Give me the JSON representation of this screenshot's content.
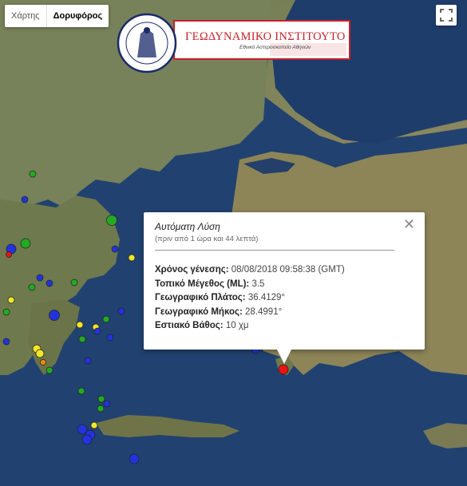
{
  "map_type_control": {
    "map_label": "Χάρτης",
    "satellite_label": "Δορυφόρος",
    "active": "satellite"
  },
  "logo": {
    "title": "ΓΕΩΔΥΝΑΜΙΚΟ ΙΝΣΤΙΤΟΥΤΟ",
    "subtitle": "Εθνικό Αστεροσκοπείο Αθηνών",
    "seal_text": "ΕΘΝΙΚΟΝ ΑΣΤΕΡΟΣΚΟΠΕΙΟΝ ΑΘΗΝΩΝ · NATIONAL OBSERVATORY OF ATHENS"
  },
  "popup": {
    "title": "Αυτόματη Λύση",
    "time_ago": "(πριν από 1 ώρα και 44 λεπτά)",
    "rows": [
      {
        "label": "Χρόνος γένεσης:",
        "value": "08/08/2018  09:58:38 (GMT)"
      },
      {
        "label": "Τοπικό Μέγεθος (ML):",
        "value": "3.5"
      },
      {
        "label": "Γεωγραφικό Πλάτος:",
        "value": "36.4129°"
      },
      {
        "label": "Γεωγραφικό Μήκος:",
        "value": "28.4991°"
      },
      {
        "label": "Εστιακό Βάθος:",
        "value": "10 χμ"
      }
    ]
  },
  "colors": {
    "sea": "#1f3f66",
    "land": "#6f7d52",
    "marker_blue": "#2233dd",
    "marker_green": "#22aa22",
    "marker_yellow": "#f2e62a",
    "marker_orange": "#f08a10",
    "marker_red": "#ee1111"
  },
  "icons": {
    "close": "close-icon",
    "fullscreen": "fullscreen-icon"
  }
}
